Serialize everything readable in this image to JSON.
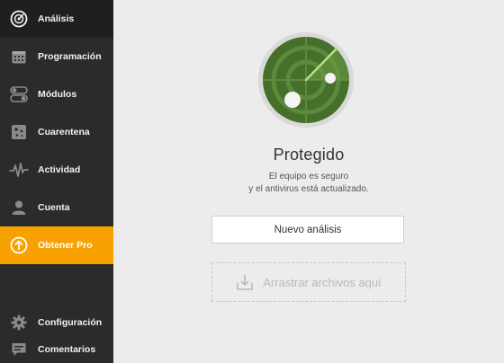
{
  "sidebar": {
    "items": [
      {
        "label": "Análisis",
        "icon": "radar-icon"
      },
      {
        "label": "Programación",
        "icon": "calendar-icon"
      },
      {
        "label": "Módulos",
        "icon": "toggles-icon"
      },
      {
        "label": "Cuarentena",
        "icon": "quarantine-icon"
      },
      {
        "label": "Actividad",
        "icon": "activity-icon"
      },
      {
        "label": "Cuenta",
        "icon": "user-icon"
      },
      {
        "label": "Obtener Pro",
        "icon": "upgrade-arrow-icon"
      }
    ],
    "bottom_items": [
      {
        "label": "Configuración",
        "icon": "gear-icon"
      },
      {
        "label": "Comentarios",
        "icon": "comment-icon"
      }
    ]
  },
  "main": {
    "status_title": "Protegido",
    "status_line1": "El equipo es seguro",
    "status_line2": "y el antivirus está actualizado.",
    "scan_button": "Nuevo análisis",
    "drop_zone": "Arrastrar archivos aquí"
  },
  "colors": {
    "sidebar_bg": "#2b2b2b",
    "active_bg": "#1f1f1f",
    "pro_accent": "#f7a200",
    "radar_green": "#4a7a2b"
  }
}
